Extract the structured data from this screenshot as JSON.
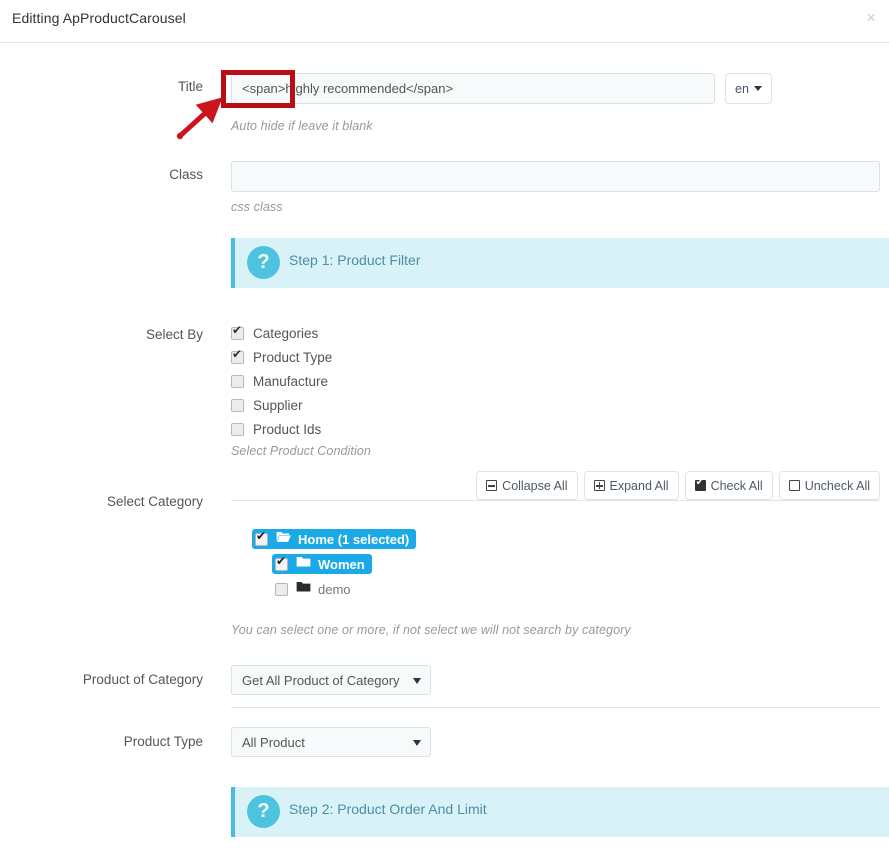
{
  "header": {
    "title": "Editting ApProductCarousel",
    "close_label": "×"
  },
  "form": {
    "title_label": "Title",
    "title_value": "<span>highly recommended</span>",
    "title_help": "Auto hide if leave it blank",
    "lang_button": "en",
    "class_label": "Class",
    "class_value": "",
    "class_placeholder": "",
    "class_help": "css class"
  },
  "step1": {
    "icon": "question-mark-icon",
    "text": "Step 1: Product Filter"
  },
  "select_by": {
    "label": "Select By",
    "help": "Select Product Condition",
    "options": [
      {
        "label": "Categories",
        "checked": true
      },
      {
        "label": "Product Type",
        "checked": true
      },
      {
        "label": "Manufacture",
        "checked": false
      },
      {
        "label": "Supplier",
        "checked": false
      },
      {
        "label": "Product Ids",
        "checked": false
      }
    ]
  },
  "tree_toolbar": {
    "collapse_all": "Collapse All",
    "expand_all": "Expand All",
    "check_all": "Check All",
    "uncheck_all": "Uncheck All"
  },
  "select_category": {
    "label": "Select Category",
    "help": "You can select one or more, if not select we will not search by category",
    "nodes": [
      {
        "label": "Home (1 selected)",
        "checked": true,
        "selected": true,
        "folder": "folder-open-icon",
        "depth": 0
      },
      {
        "label": "Women",
        "checked": true,
        "selected": true,
        "folder": "folder-icon",
        "depth": 1
      },
      {
        "label": "demo",
        "checked": false,
        "selected": false,
        "folder": "folder-icon",
        "depth": 1
      }
    ]
  },
  "product_of_category": {
    "label": "Product of Category",
    "value": "Get All Product of Category"
  },
  "product_type": {
    "label": "Product Type",
    "value": "All Product"
  },
  "step2": {
    "icon": "question-mark-icon",
    "text": "Step 2: Product Order And Limit"
  },
  "annotations": {
    "highlight_color": "#b80f17",
    "arrow_color": "#c9151b"
  }
}
